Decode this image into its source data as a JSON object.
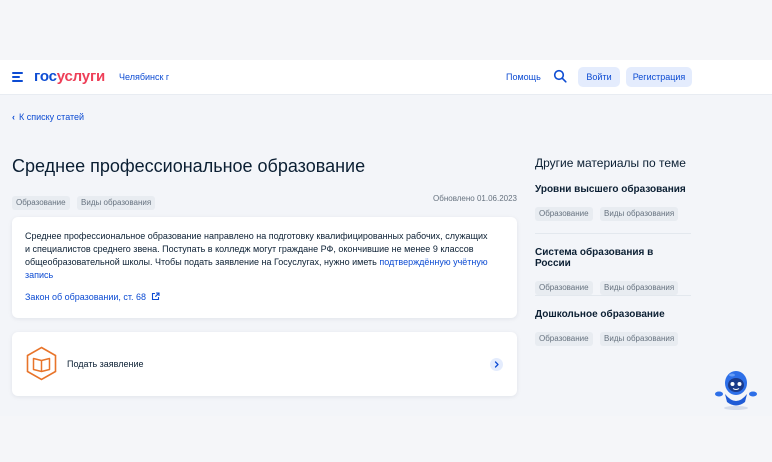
{
  "header": {
    "logo_gos": "гос",
    "logo_uslugi": "услуги",
    "city": "Челябинск г",
    "help": "Помощь",
    "login": "Войти",
    "register": "Регистрация"
  },
  "nav": {
    "back": "К списку статей"
  },
  "article": {
    "title": "Среднее профессиональное образование",
    "tags": [
      "Образование",
      "Виды образования"
    ],
    "updated": "Обновлено 01.06.2023",
    "text": "Среднее профессиональное образование направлено на подготовку квалифицированных рабочих, служащих и специалистов среднего звена. Поступать в колледж могут граждане РФ, окончившие не менее 9 классов общеобразовательной школы. Чтобы подать заявление на Госуслугах, нужно иметь ",
    "text_link": "подтверждённую учётную запись",
    "law_link": "Закон об образовании, ст. 68",
    "apply": "Подать заявление"
  },
  "sidebar": {
    "title": "Другие материалы по теме",
    "items": [
      {
        "name": "Уровни высшего образования",
        "tags": [
          "Образование",
          "Виды образования"
        ]
      },
      {
        "name": "Система образования в России",
        "tags": [
          "Образование",
          "Виды образования"
        ]
      },
      {
        "name": "Дошкольное образование",
        "tags": [
          "Образование",
          "Виды образования"
        ]
      }
    ]
  },
  "colors": {
    "accent": "#0d4cd3",
    "brand_red": "#ee3f58",
    "apply_icon": "#e8742a"
  },
  "icons": [
    "burger-menu-icon",
    "search-icon",
    "chevron-left-icon",
    "external-link-icon",
    "book-icon",
    "chevron-right-icon",
    "assistant-robot-icon"
  ]
}
